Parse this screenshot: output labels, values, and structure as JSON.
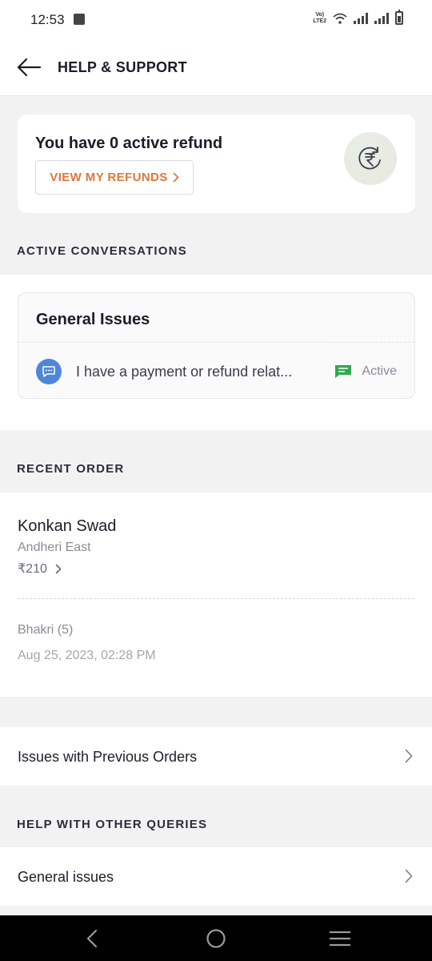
{
  "status_bar": {
    "time": "12:53",
    "volte_line1": "Vo)",
    "volte_line2": "LTE2"
  },
  "header": {
    "title": "HELP & SUPPORT",
    "back_icon": "arrow-left-icon"
  },
  "refund": {
    "title": "You have 0 active refund",
    "button_label": "VIEW MY REFUNDS",
    "icon": "rupee-refresh-icon"
  },
  "active_conversations": {
    "section_label": "ACTIVE CONVERSATIONS",
    "card_title": "General Issues",
    "conversation_text": "I have a payment or refund relat...",
    "status": "Active"
  },
  "recent_order": {
    "section_label": "RECENT ORDER",
    "restaurant": "Konkan Swad",
    "area": "Andheri East",
    "price": "₹210",
    "items": "Bhakri (5)",
    "date": "Aug 25, 2023, 02:28 PM"
  },
  "previous_orders": {
    "label": "Issues with Previous Orders"
  },
  "other_queries": {
    "section_label": "HELP WITH OTHER QUERIES",
    "items": [
      {
        "label": "General issues"
      }
    ]
  },
  "colors": {
    "accent": "#e0763a",
    "chat_blue": "#4f86d9",
    "active_green": "#2fa84f"
  }
}
